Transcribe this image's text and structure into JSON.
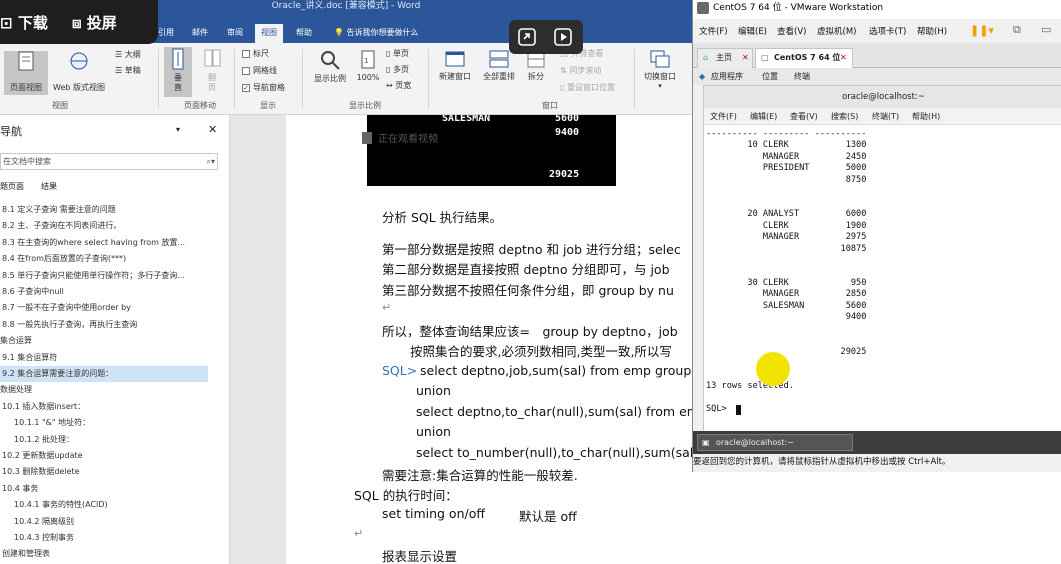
{
  "recorder": {
    "download": "下载",
    "cast": "投屏"
  },
  "word": {
    "title": "Oracle_讲义.doc [兼容模式] - Word",
    "tabs": [
      "引用",
      "邮件",
      "审阅",
      "视图",
      "帮助"
    ],
    "active_tab": "视图",
    "tell_me": "告诉我你想要做什么",
    "ribbon": {
      "view_group_label": "视图",
      "page_view": "页面视图",
      "web_layout": "Web 版式视图",
      "outline": "大纲",
      "draft": "草稿",
      "vertical": "垂直",
      "page": "翻页",
      "page_movement_label": "页面移动",
      "ruler": "标尺",
      "gridlines": "网格线",
      "nav_pane": "导航窗格",
      "show_label": "显示",
      "zoom": "显示比例",
      "zoom_100": "100%",
      "one_page": "单页",
      "multi_page": "多页",
      "page_width": "页宽",
      "zoom_label": "显示比例",
      "new_window": "新建窗口",
      "arrange_all": "全部重排",
      "split": "拆分",
      "side_by_side": "并排查看",
      "sync_scroll": "同步滚动",
      "reset_pos": "重设窗口位置",
      "window_label": "窗口",
      "switch_window": "切换窗口"
    },
    "nav": {
      "title": "导航",
      "search_placeholder": "在文档中搜索",
      "tabs": [
        "标题",
        "页面",
        "结果"
      ],
      "items": [
        "8.1 定义子查询 需要注意的问题",
        "8.2 主、子查询在不同表间进行。",
        "8.3 在主查询的where select having from 放置...",
        "8.4 在from后面放置的子查询(***)",
        "8.5 单行子查询只能使用单行操作符；多行子查询...",
        "8.6 子查询中null",
        "8.7 一般不在子查询中使用order by",
        "8.8 一般先执行子查询，再执行主查询",
        "集合运算",
        "9.1 集合运算符",
        "9.2 集合运算需要注意的问题：",
        "数据处理",
        "10.1 插入数据insert：",
        "10.1.1 \"&\" 地址符：",
        "10.1.2 批处理：",
        "10.2 更新数据update",
        "10.3 删除数据delete",
        "10.4 事务",
        "10.4.1 事务的特性(ACID)",
        "10.4.2 隔离级别",
        "10.4.3 控制事务",
        "创建和管理表"
      ],
      "selected_index": 10
    },
    "document": {
      "screenshot_rows": [
        {
          "job": "SALESMAN",
          "sal": "5600"
        },
        {
          "job": "",
          "sal": "9400"
        },
        {
          "job": "",
          "sal": "29025"
        }
      ],
      "watch_video": "正在观看视频",
      "lines": [
        "分析 SQL 执行结果。",
        "第一部分数据是按照 deptno 和 job 进行分组；selec",
        "第二部分数据是直接按照 deptno 分组即可，与 job",
        "第三部分数据不按照任何条件分组，即 group by nu",
        "所以，整体查询结果应该=　group by deptno，job",
        "按照集合的要求,必须列数相同,类型一致,所以写",
        "SQL>",
        "select deptno,job,sum(sal) from emp group by d",
        "union",
        "select deptno,to_char(null),sum(sal) from emp gr",
        "union",
        "select to_number(null),to_char(null),sum(sal) fro",
        "需要注意:集合运算的性能一般较差.",
        "SQL 的执行时间：",
        "set timing on/off",
        "默认是 off",
        "报表显示设置"
      ]
    }
  },
  "vmware": {
    "title": "CentOS 7 64 位 - VMware Workstation",
    "menu": [
      "文件(F)",
      "编辑(E)",
      "查看(V)",
      "虚拟机(M)",
      "选项卡(T)",
      "帮助(H)"
    ],
    "tabs": [
      {
        "label": "主页"
      },
      {
        "label": "CentOS 7 64 位"
      }
    ],
    "gnome_bar": [
      "应用程序",
      "位置",
      "终端"
    ],
    "terminal": {
      "title": "oracle@localhost:~",
      "menu": [
        "文件(F)",
        "编辑(E)",
        "查看(V)",
        "搜索(S)",
        "终端(T)",
        "帮助(H)"
      ],
      "lines": [
        "---------- --------- ----------",
        "        10 CLERK           1300",
        "           MANAGER         2450",
        "           PRESIDENT       5000",
        "                           8750",
        "",
        "",
        "        20 ANALYST         6000",
        "           CLERK           1900",
        "           MANAGER         2975",
        "                          10875",
        "",
        "",
        "        30 CLERK            950",
        "           MANAGER         2850",
        "           SALESMAN        5600",
        "                           9400",
        "",
        "",
        "                          29025",
        "",
        "",
        "13 rows selected.",
        "",
        "SQL> "
      ]
    },
    "taskbar_item": "oracle@localhost:~",
    "status": "要返回到您的计算机，请将鼠标指针从虚拟机中移出或按 Ctrl+Alt。"
  }
}
